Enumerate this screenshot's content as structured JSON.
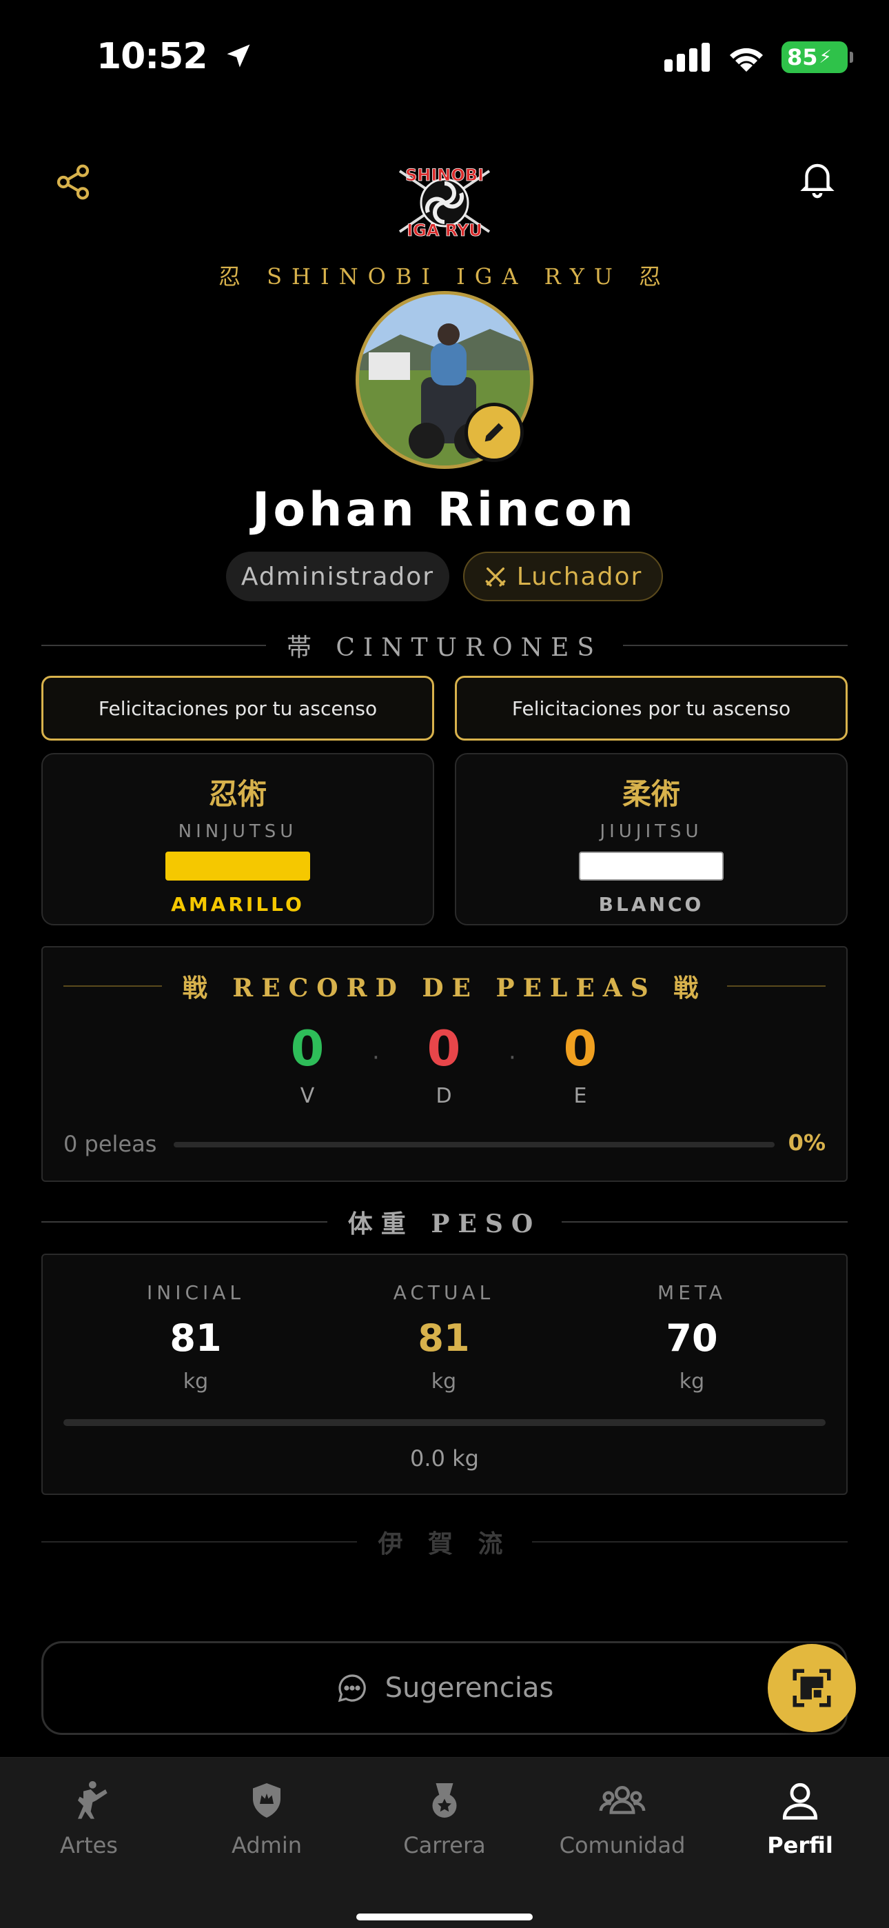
{
  "status_bar": {
    "time": "10:52",
    "battery": "85"
  },
  "header": {
    "clan_title": "忍 SHINOBI IGA RYU 忍",
    "share_icon": "share-icon",
    "bell_icon": "bell-icon",
    "logo_text_line1": "SHINOBI",
    "logo_text_line2": "IGA RYU"
  },
  "profile": {
    "name": "Johan Rincon",
    "role_admin": "Administrador",
    "role_fighter": "Luchador"
  },
  "belts": {
    "section_label": "帯 CINTURONES",
    "cards": [
      {
        "congrats": "Felicitaciones por tu ascenso",
        "kanji": "忍術",
        "art": "NINJUTSU",
        "color_name": "AMARILLO",
        "swatch": "#f5c800",
        "text_color": "#f5c800"
      },
      {
        "congrats": "Felicitaciones por tu ascenso",
        "kanji": "柔術",
        "art": "JIUJITSU",
        "color_name": "BLANCO",
        "swatch": "#ffffff",
        "text_color": "#b0b0b0"
      }
    ]
  },
  "record": {
    "section_label": "戦 RECORD DE PELEAS 戦",
    "wins": "0",
    "losses": "0",
    "draws": "0",
    "wins_label": "V",
    "losses_label": "D",
    "draws_label": "E",
    "fights_text": "0 peleas",
    "percent": "0%",
    "progress": 0,
    "colors": {
      "wins": "#2ebd59",
      "losses": "#e8464a",
      "draws": "#f0a020"
    }
  },
  "weight": {
    "section_label": "体重 PESO",
    "initial_label": "INICIAL",
    "initial_value": "81",
    "current_label": "ACTUAL",
    "current_value": "81",
    "goal_label": "META",
    "goal_value": "70",
    "unit": "kg",
    "delta_text": "0.0 kg",
    "progress": 0
  },
  "footer_divider": "伊 賀 流",
  "suggestions_button": "Sugerencias",
  "tabs": [
    {
      "label": "Artes",
      "icon": "martial-arts-kick-icon"
    },
    {
      "label": "Admin",
      "icon": "shield-crown-icon"
    },
    {
      "label": "Carrera",
      "icon": "medal-icon"
    },
    {
      "label": "Comunidad",
      "icon": "community-icon"
    },
    {
      "label": "Perfil",
      "icon": "person-icon",
      "active": true
    }
  ],
  "accent_color": "#d8b24c"
}
